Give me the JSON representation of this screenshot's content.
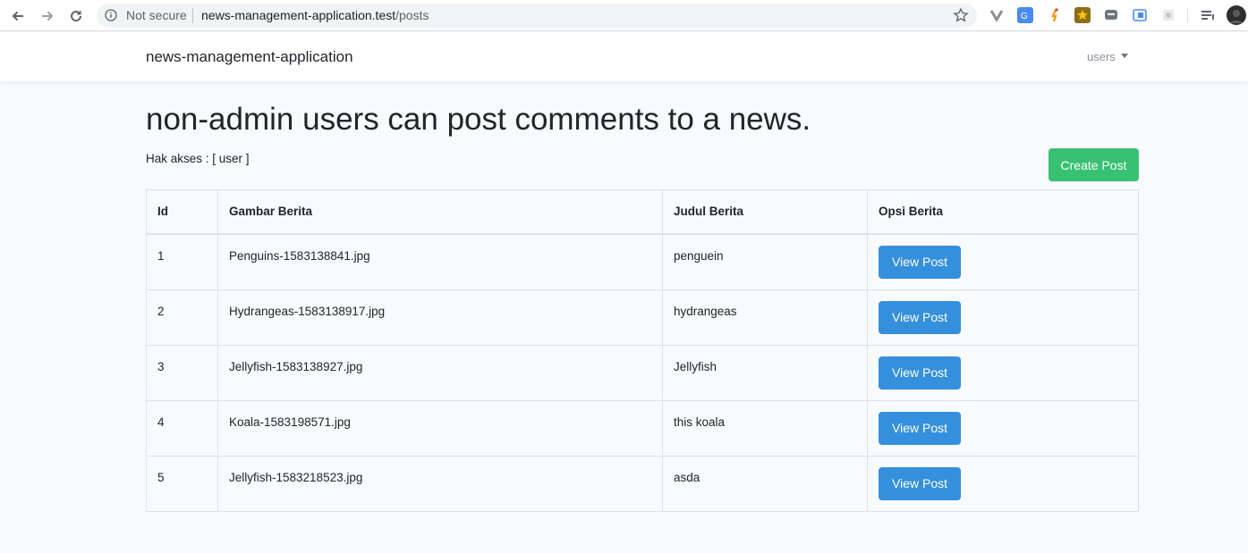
{
  "browser": {
    "security_label": "Not secure",
    "url_host": "news-management-application.test",
    "url_path": "/posts",
    "icons": [
      "back-icon",
      "forward-icon",
      "reload-icon",
      "info-icon",
      "bookmark-star-icon",
      "menu-icon",
      "profile-avatar"
    ]
  },
  "navbar": {
    "brand": "news-management-application",
    "user_menu_label": "users"
  },
  "page": {
    "title": "non-admin users can post comments to a news.",
    "access_label": "Hak akses : [ user ]",
    "create_button": "Create Post"
  },
  "table": {
    "headers": [
      "Id",
      "Gambar Berita",
      "Judul Berita",
      "Opsi Berita"
    ],
    "view_button_label": "View Post",
    "rows": [
      {
        "id": "1",
        "image": "Penguins-1583138841.jpg",
        "title": "penguein"
      },
      {
        "id": "2",
        "image": "Hydrangeas-1583138917.jpg",
        "title": "hydrangeas"
      },
      {
        "id": "3",
        "image": "Jellyfish-1583138927.jpg",
        "title": "Jellyfish"
      },
      {
        "id": "4",
        "image": "Koala-1583198571.jpg",
        "title": "this koala"
      },
      {
        "id": "5",
        "image": "Jellyfish-1583218523.jpg",
        "title": "asda"
      }
    ]
  },
  "colors": {
    "create_button": "#38c172",
    "view_button": "#3490dc",
    "page_background": "#f8fafc"
  }
}
